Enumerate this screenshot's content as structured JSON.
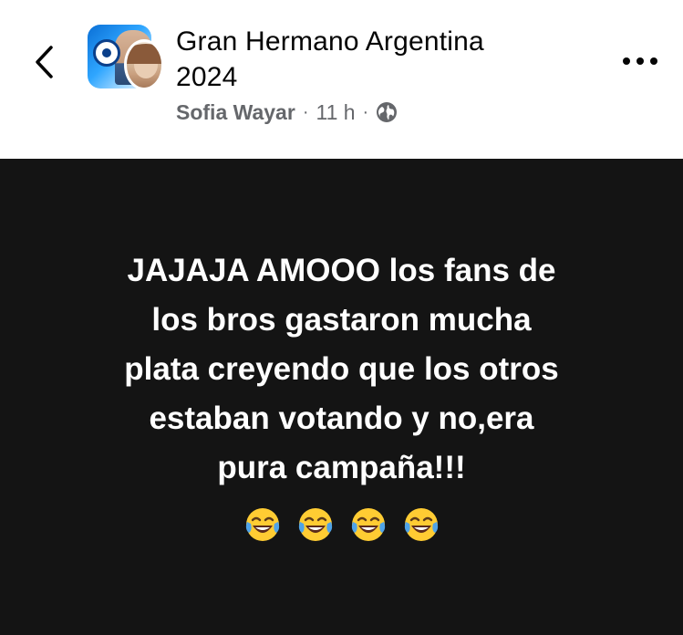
{
  "header": {
    "back_icon": "chevron-left-icon",
    "group_title": "Gran Hermano Argentina\n2024",
    "author": "Sofia Wayar",
    "separator": "·",
    "time": "11 h",
    "privacy_icon": "globe-icon",
    "more_icon": "more-horizontal-icon"
  },
  "post": {
    "background_color": "#141414",
    "text": "JAJAJA AMOOO  los fans de\nlos bros gastaron mucha\nplata creyendo que los otros\nestaban votando y no,era\npura campaña!!!",
    "emojis": [
      "face-with-tears-of-joy-icon",
      "face-with-tears-of-joy-icon",
      "face-with-tears-of-joy-icon",
      "face-with-tears-of-joy-icon"
    ]
  }
}
